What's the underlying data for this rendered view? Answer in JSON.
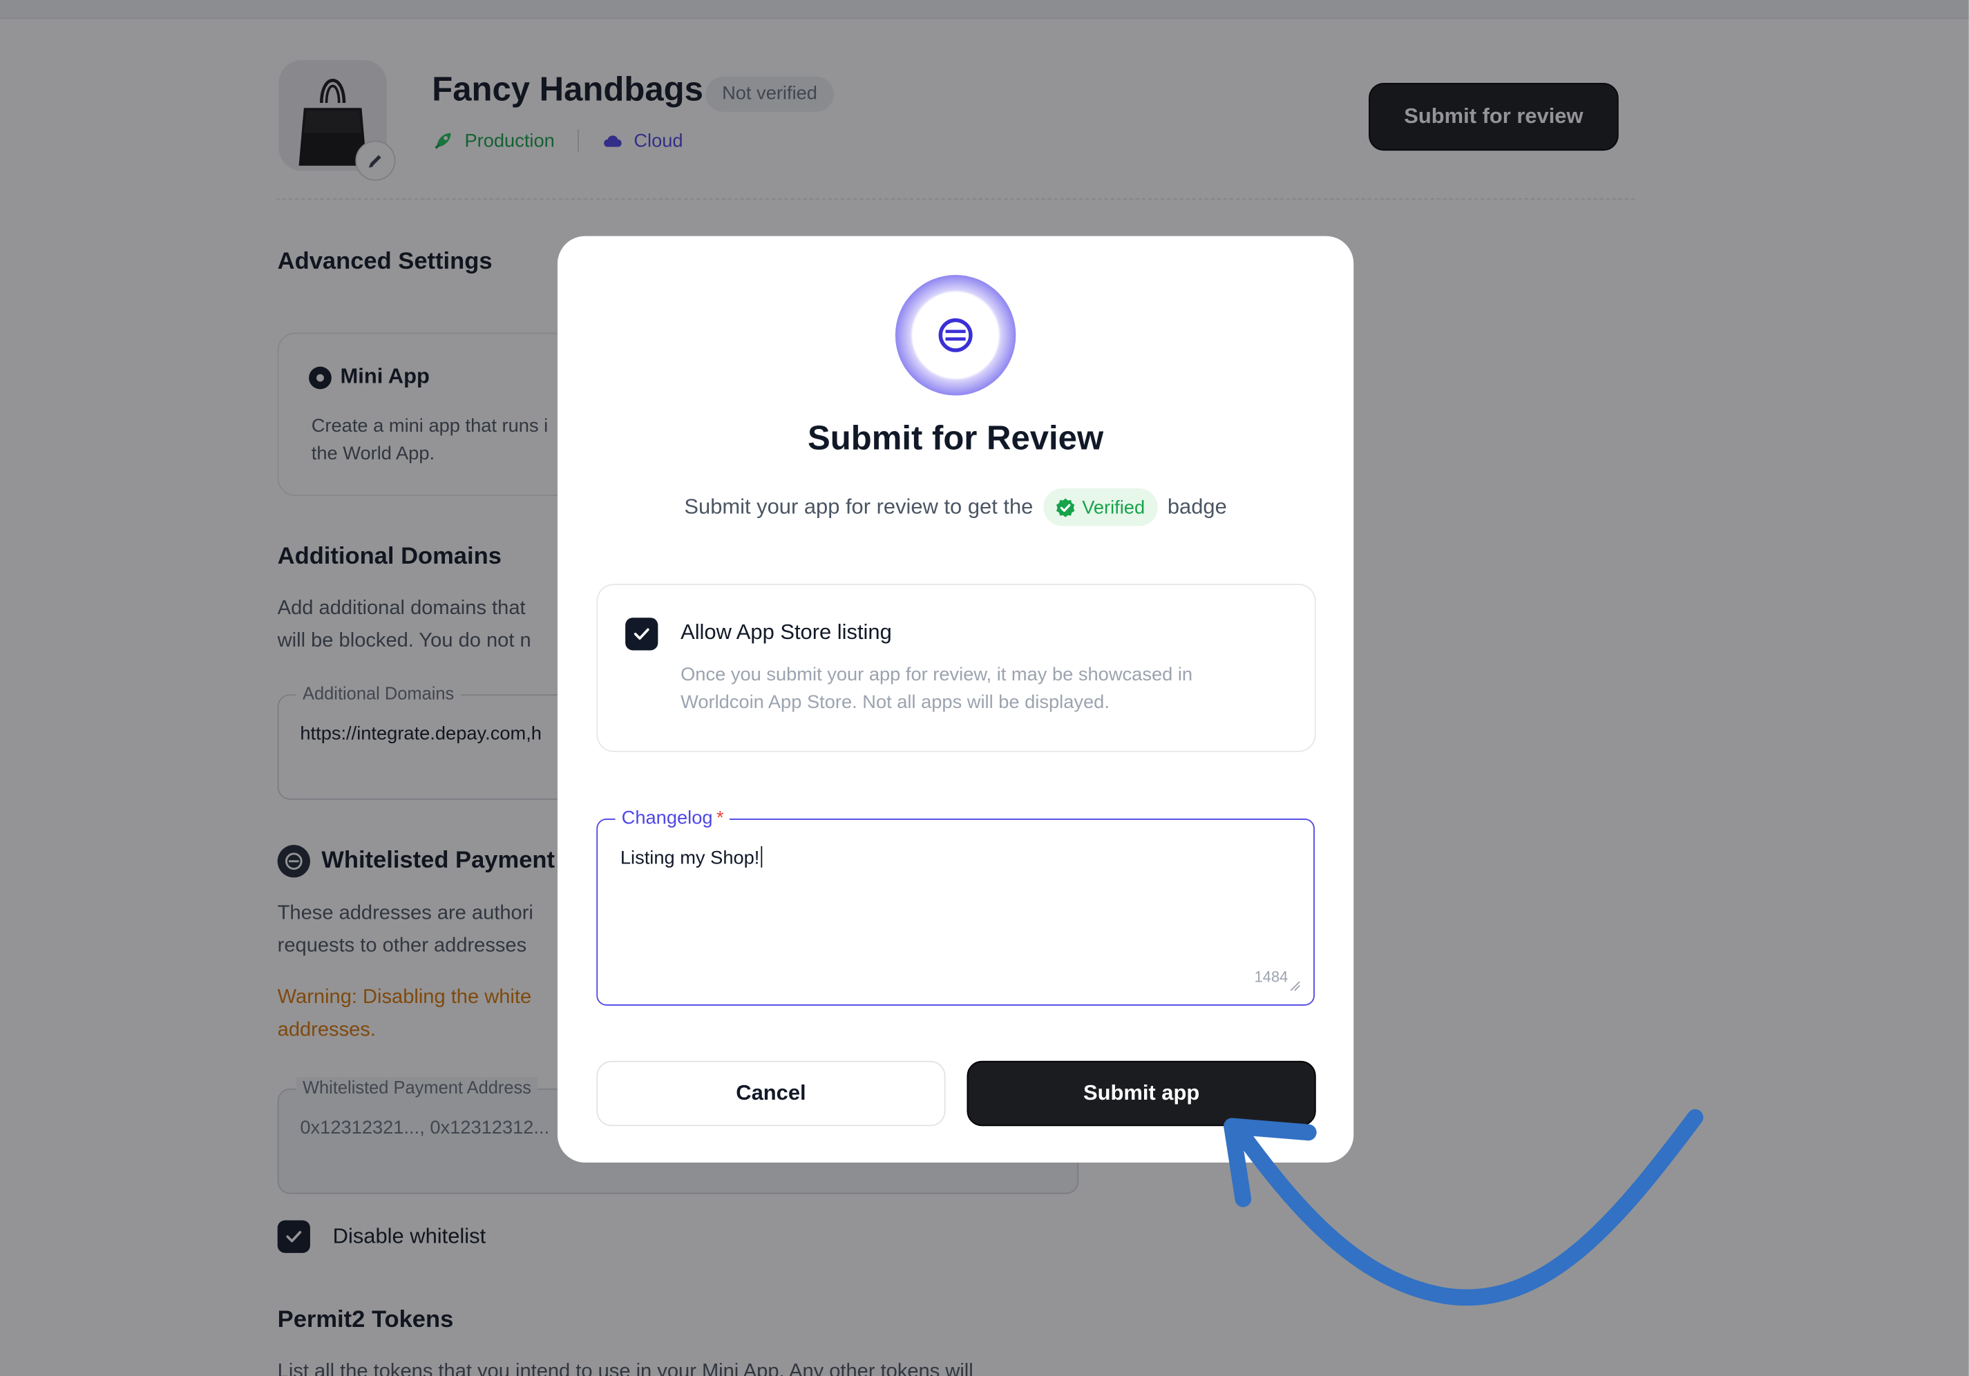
{
  "app": {
    "name": "Fancy Handbags",
    "status_badge": "Not verified",
    "environment": "Production",
    "engine": "Cloud"
  },
  "header": {
    "submit_review_label": "Submit for review"
  },
  "settings": {
    "advanced_title": "Advanced Settings",
    "mini_app": {
      "title": "Mini App",
      "desc_line1": "Create a mini app that runs i",
      "desc_line2": "the World App."
    },
    "additional_domains": {
      "title": "Additional Domains",
      "desc_line1": "Add additional domains that",
      "desc_line2": "will be blocked. You do not n",
      "field_label": "Additional Domains",
      "field_value": "https://integrate.depay.com,h"
    },
    "whitelisted_payments": {
      "title": "Whitelisted Payment",
      "desc_line1": "These addresses are authori",
      "desc_line2": "requests to other addresses",
      "warning_line1": "Warning: Disabling the white",
      "warning_line2": "addresses.",
      "field_label": "Whitelisted Payment Address",
      "field_placeholder": "0x12312321..., 0x12312312...",
      "disable_label": "Disable whitelist",
      "disable_checked": true
    },
    "permit2": {
      "title": "Permit2 Tokens",
      "desc": "List all the tokens that you intend to use in your Mini App. Any other tokens will"
    }
  },
  "modal": {
    "title": "Submit for Review",
    "subtitle_prefix": "Submit your app for review to get the",
    "verified_label": "Verified",
    "subtitle_suffix": "badge",
    "listing": {
      "label": "Allow App Store listing",
      "checked": true,
      "desc_line1": "Once you submit your app for review, it may be showcased in",
      "desc_line2": "Worldcoin App Store. Not all apps will be displayed."
    },
    "changelog": {
      "label": "Changelog",
      "required_mark": "*",
      "value": "Listing my Shop!",
      "remaining_chars": "1484"
    },
    "cancel_label": "Cancel",
    "submit_label": "Submit app"
  },
  "colors": {
    "accent": "#4f46e5",
    "success": "#16a34a",
    "warning": "#d97706",
    "dark_button": "#1b1c20",
    "annotation_arrow": "#3271c4"
  }
}
